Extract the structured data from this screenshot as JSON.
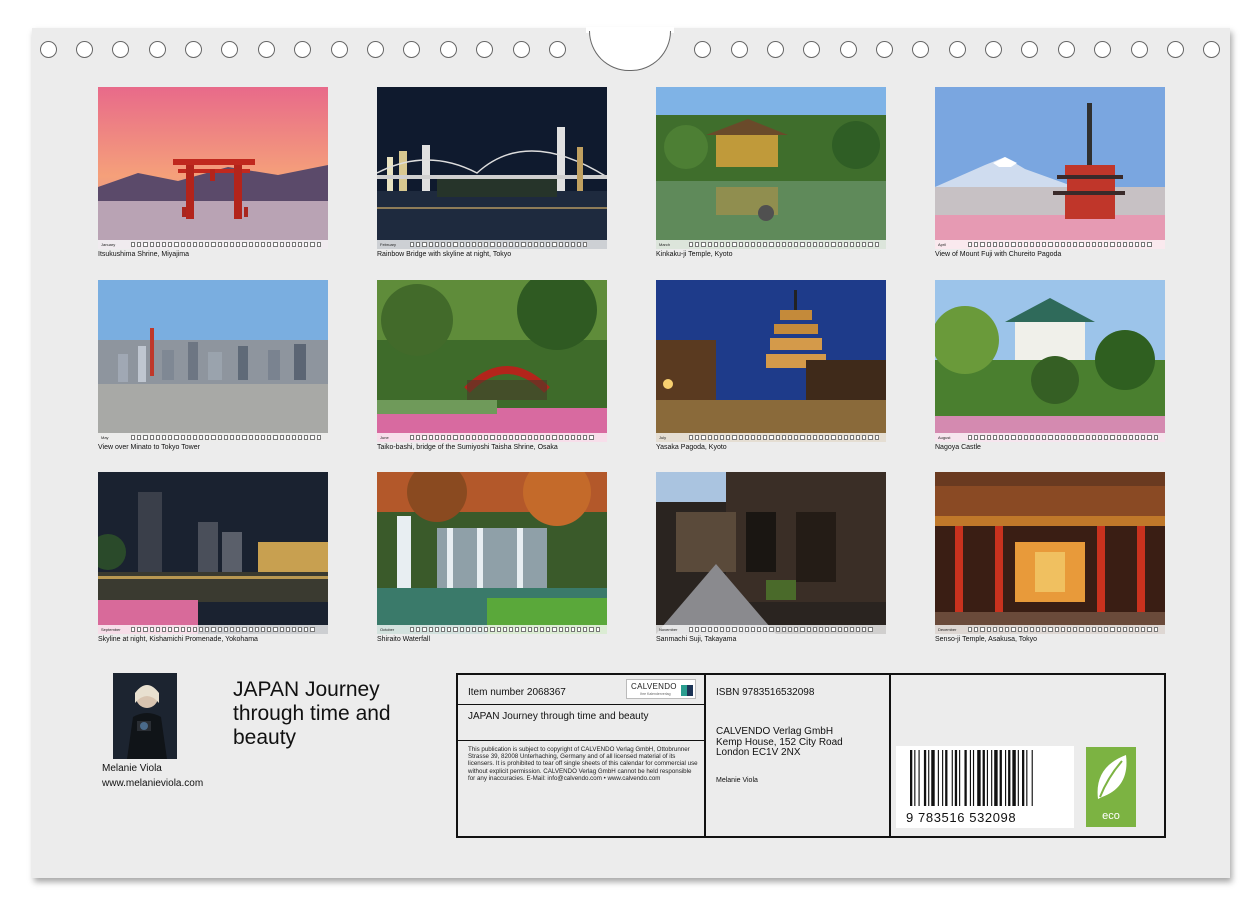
{
  "photos": [
    {
      "month": "January",
      "caption": "Itsukushima Shrine, Miyajima",
      "days": 31
    },
    {
      "month": "February",
      "caption": "Rainbow Bridge with skyline at night, Tokyo",
      "days": 29
    },
    {
      "month": "March",
      "caption": "Kinkaku-ji Temple, Kyoto",
      "days": 31
    },
    {
      "month": "April",
      "caption": "View of Mount Fuji with Chureito Pagoda",
      "days": 30
    },
    {
      "month": "May",
      "caption": "View over Minato to Tokyo Tower",
      "days": 31
    },
    {
      "month": "June",
      "caption": "Taiko-bashi, bridge of the Sumiyoshi Taisha Shrine, Osaka",
      "days": 30
    },
    {
      "month": "July",
      "caption": "Yasaka Pagoda, Kyoto",
      "days": 31
    },
    {
      "month": "August",
      "caption": "Nagoya Castle",
      "days": 31
    },
    {
      "month": "September",
      "caption": "Skyline at night, Kishamichi Promenade, Yokohama",
      "days": 30
    },
    {
      "month": "October",
      "caption": "Shiraito Waterfall",
      "days": 31
    },
    {
      "month": "November",
      "caption": "Sanmachi Suji, Takayama",
      "days": 30
    },
    {
      "month": "December",
      "caption": "Senso-ji Temple, Asakusa, Tokyo",
      "days": 31
    }
  ],
  "author": {
    "name": "Melanie Viola",
    "url": "www.melanieviola.com"
  },
  "title": {
    "line1": "JAPAN Journey",
    "line2": "through time and",
    "line3": "beauty"
  },
  "info": {
    "item_number": "Item number 2068367",
    "calvendo_logo": "CALVENDO",
    "calvendo_sub": "Ihre Kalenderverlag",
    "product_title": "JAPAN Journey through time and beauty",
    "legal": "This publication is subject to copyright of CALVENDO Verlag GmbH, Ottobrunner Strasse 39, 82008 Unterhaching, Germany and of all licensed material of its licensers. It is prohibited to tear off single sheets of this calendar for commercial use without explicit permission. CALVENDO Verlag GmbH cannot be held responsible for any inaccuracies. E-Mail: info@calvendo.com • www.calvendo.com",
    "isbn": "ISBN 9783516532098",
    "publisher_line1": "CALVENDO Verlag GmbH",
    "publisher_line2": "Kemp House, 152 City Road",
    "publisher_line3": "London EC1V 2NX",
    "publisher_author": "Melanie Viola",
    "barcode_digits": "9 783516 532098",
    "eco_label": "eco"
  },
  "colors": {
    "sheet": "#ececec",
    "eco": "#7cb342",
    "border": "#111111"
  }
}
